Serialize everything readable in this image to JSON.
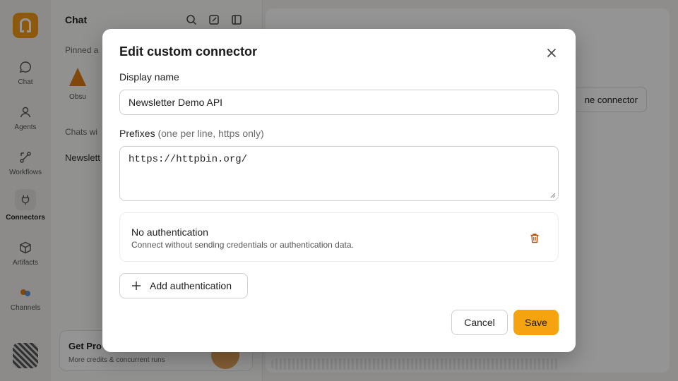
{
  "colors": {
    "accent": "#f5a30f",
    "overlay": "rgba(0,0,0,0.42)"
  },
  "rail": {
    "items": [
      {
        "label": "Chat",
        "icon": "chat-bubble-icon"
      },
      {
        "label": "Agents",
        "icon": "person-icon"
      },
      {
        "label": "Workflows",
        "icon": "workflow-icon"
      },
      {
        "label": "Connectors",
        "icon": "plug-icon",
        "active": true
      },
      {
        "label": "Artifacts",
        "icon": "cube-icon"
      },
      {
        "label": "Channels",
        "icon": "channels-icon"
      }
    ]
  },
  "sidepanel": {
    "title": "Chat",
    "pinned_label": "Pinned a",
    "agent_name": "Obsu",
    "chats_label": "Chats wi",
    "chat_item": "Newslett"
  },
  "promo": {
    "title": "Get Pro",
    "subtitle": "More credits & concurrent runs"
  },
  "main": {
    "new_connector_label": "ne connector"
  },
  "modal": {
    "title": "Edit custom connector",
    "display_name_label": "Display name",
    "display_name_value": "Newsletter Demo API",
    "prefixes_label": "Prefixes",
    "prefixes_hint": "(one per line, https only)",
    "prefixes_value": "https://httpbin.org/",
    "auth": {
      "title": "No authentication",
      "description": "Connect without sending credentials or authentication data."
    },
    "add_auth_label": "Add authentication",
    "cancel_label": "Cancel",
    "save_label": "Save"
  }
}
